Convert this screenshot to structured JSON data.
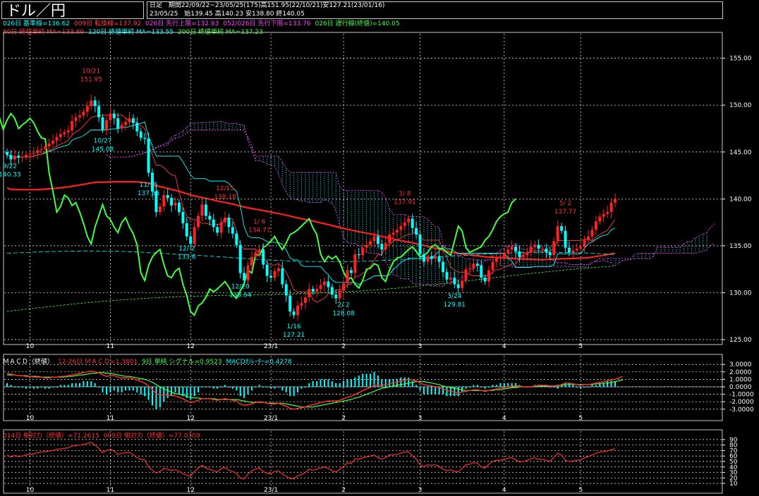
{
  "header": {
    "title": "ドル／円",
    "period_label": "日足",
    "range_line": "期間22/09/22~23/05/25(175)高151.95(22/10/21)安127.21(23/01/16)",
    "last_date": "23/05/25",
    "ohlc_line": "始139.45 高140.23 安138.80 終140.05"
  },
  "legend_main_1": [
    {
      "text": "026日 基準線=136.62",
      "color": "#00ffff"
    },
    {
      "text": "009日 転換線=137.92",
      "color": "#ff4040"
    },
    {
      "text": "026日 先行上限=132.93",
      "color": "#ff40ff"
    },
    {
      "text": "052/026日 先行下限=133.76",
      "color": "#ff40ff"
    },
    {
      "text": "026日 遅行線(終値)=140.05",
      "color": "#40ff40"
    }
  ],
  "legend_main_2": [
    {
      "text": "80日 終値単純 MA=133.80",
      "color": "#ff3030"
    },
    {
      "text": "120日 終値単純 MA=133.55",
      "color": "#00ffff"
    },
    {
      "text": "200日 終値単純 MA=137.23",
      "color": "#40ff40"
    }
  ],
  "legend_macd": [
    {
      "text": "ＭＡＣＤ（終値）",
      "color": "#ffffff"
    },
    {
      "text": "12-26日 ＭＡＣＤ=1.3801",
      "color": "#ff3030"
    },
    {
      "text": "9日 単純 シグナル=0.9523",
      "color": "#40ff40"
    },
    {
      "text": "MACDｵｼﾚｰﾀｰ=0.4278",
      "color": "#00ffff"
    }
  ],
  "legend_rsi": [
    {
      "text": "014日 相対力（終値）=71.2615",
      "color": "#ff3030"
    },
    {
      "text": "009日 相対力（終値）=77.0309",
      "color": "#ff3030"
    }
  ],
  "chart_data": [
    {
      "type": "candlestick",
      "title": "ドル／円",
      "ylim": [
        125,
        157
      ],
      "y_ticks": [
        "155.00",
        "150.00",
        "145.00",
        "140.00",
        "135.00",
        "130.00",
        "125.00"
      ],
      "x_ticks": [
        {
          "label": "10",
          "index": 6
        },
        {
          "label": "11",
          "index": 27
        },
        {
          "label": "12",
          "index": 48
        },
        {
          "label": "23/1",
          "index": 69
        },
        {
          "label": "2",
          "index": 88
        },
        {
          "label": "3",
          "index": 108
        },
        {
          "label": "4",
          "index": 130
        },
        {
          "label": "5",
          "index": 150
        }
      ],
      "close": [
        144.7,
        144.2,
        144.6,
        144.4,
        144.5,
        144.7,
        144.8,
        144.9,
        145.2,
        145.3,
        145.6,
        145.9,
        146.2,
        146.6,
        146.9,
        147.1,
        147.3,
        148.3,
        148.7,
        148.9,
        149.3,
        149.9,
        150.5,
        149.9,
        148.7,
        147.4,
        148.4,
        149.1,
        148.6,
        147.5,
        147.9,
        148.2,
        148.6,
        148.1,
        147.2,
        146.5,
        146.4,
        142.8,
        140.8,
        138.6,
        139.2,
        140.4,
        140.1,
        139.3,
        139.6,
        138.6,
        137.4,
        136.0,
        135.2,
        137.0,
        138.2,
        139.4,
        138.2,
        137.8,
        137.0,
        136.4,
        137.5,
        138.0,
        137.0,
        136.3,
        135.1,
        132.1,
        131.3,
        132.9,
        133.8,
        134.3,
        134.6,
        133.0,
        131.8,
        131.6,
        132.3,
        132.6,
        130.9,
        129.7,
        128.0,
        127.6,
        128.6,
        128.9,
        129.5,
        130.4,
        130.1,
        130.4,
        130.8,
        131.2,
        130.6,
        129.8,
        129.4,
        130.2,
        131.0,
        132.4,
        132.1,
        134.1,
        134.0,
        134.8,
        135.1,
        135.5,
        136.0,
        135.2,
        134.6,
        135.3,
        136.2,
        136.4,
        136.7,
        137.1,
        137.5,
        137.9,
        136.9,
        136.2,
        134.1,
        133.3,
        133.9,
        133.6,
        133.9,
        133.3,
        132.2,
        131.4,
        131.6,
        130.9,
        130.5,
        131.3,
        132.5,
        132.6,
        133.1,
        132.9,
        131.6,
        131.2,
        132.4,
        133.3,
        133.7,
        133.8,
        134.2,
        134.6,
        134.9,
        134.4,
        133.8,
        134.0,
        134.3,
        134.9,
        135.1,
        134.7,
        134.7,
        134.3,
        134.0,
        135.5,
        137.1,
        136.6,
        134.8,
        134.3,
        134.5,
        134.7,
        134.9,
        135.6,
        136.0,
        136.7,
        137.6,
        138.1,
        138.4,
        138.6,
        139.6,
        140.0
      ],
      "highs_labels": [
        {
          "date": "10/21",
          "value": "151.95",
          "index": 22
        },
        {
          "date": "12/15",
          "value": "138.18",
          "index": 57
        },
        {
          "date": "3/ 8",
          "value": "137.91",
          "index": 104
        },
        {
          "date": "5/ 2",
          "value": "137.77",
          "index": 146
        },
        {
          "date": "1/ 6",
          "value": "134.77",
          "index": 66
        }
      ],
      "lows_labels": [
        {
          "date": "10/27",
          "value": "145.08",
          "index": 25
        },
        {
          "date": "11/15",
          "value": "137.65",
          "index": 37
        },
        {
          "date": "12/ 2",
          "value": "133.6",
          "index": 47
        },
        {
          "date": "12/20",
          "value": "130.54",
          "index": 61
        },
        {
          "date": "1/16",
          "value": "127.21",
          "index": 75
        },
        {
          "date": "2/ 2",
          "value": "128.08",
          "index": 88
        },
        {
          "date": "3/24",
          "value": "129.81",
          "index": 117
        },
        {
          "date": "9/22",
          "value": "140.33",
          "index": 0
        }
      ],
      "series": [
        {
          "name": "026日 基準線",
          "last": 136.62,
          "color": "#00ffff"
        },
        {
          "name": "009日 転換線",
          "last": 137.92,
          "color": "#ff4040"
        },
        {
          "name": "026日 先行上限",
          "last": 132.93,
          "color": "#ff40ff"
        },
        {
          "name": "052/026日 先行下限",
          "last": 133.76,
          "color": "#ff40ff"
        },
        {
          "name": "026日 遅行線(終値)",
          "last": 140.05,
          "color": "#40ff40"
        },
        {
          "name": "80日 終値単純 MA",
          "last": 133.8,
          "color": "#ff3030"
        },
        {
          "name": "120日 終値単純 MA",
          "last": 133.55,
          "color": "#00ffff"
        },
        {
          "name": "200日 終値単純 MA",
          "last": 137.23,
          "color": "#40ff40"
        }
      ],
      "colors": {
        "up": "#ff2020",
        "down": "#00ffff",
        "grid": "#ffffff"
      }
    },
    {
      "type": "line",
      "title": "ＭＡＣＤ（終値）",
      "ylim": [
        -3.4,
        3.4
      ],
      "y_ticks": [
        "3.0000",
        "2.0000",
        "1.0000",
        "0.0000",
        "-1.0000",
        "-2.0000",
        "-3.0000"
      ],
      "macd": [
        1.8,
        1.7,
        1.6,
        1.5,
        1.5,
        1.4,
        1.4,
        1.3,
        1.3,
        1.3,
        1.2,
        1.2,
        1.3,
        1.3,
        1.4,
        1.4,
        1.5,
        1.6,
        1.7,
        1.8,
        1.9,
        2.0,
        2.1,
        2.0,
        1.9,
        1.6,
        1.4,
        1.5,
        1.5,
        1.3,
        1.2,
        1.2,
        1.2,
        1.1,
        0.9,
        0.7,
        0.5,
        0.1,
        -0.4,
        -0.9,
        -1.1,
        -1.1,
        -1.1,
        -1.2,
        -1.2,
        -1.4,
        -1.6,
        -1.9,
        -2.1,
        -2.0,
        -1.8,
        -1.6,
        -1.6,
        -1.6,
        -1.7,
        -1.8,
        -1.7,
        -1.6,
        -1.7,
        -1.8,
        -1.9,
        -2.3,
        -2.5,
        -2.4,
        -2.3,
        -2.1,
        -2.0,
        -2.1,
        -2.2,
        -2.3,
        -2.3,
        -2.2,
        -2.4,
        -2.6,
        -2.9,
        -3.0,
        -2.9,
        -2.8,
        -2.7,
        -2.5,
        -2.4,
        -2.3,
        -2.1,
        -2.0,
        -1.9,
        -1.9,
        -1.9,
        -1.8,
        -1.6,
        -1.4,
        -1.3,
        -1.0,
        -0.8,
        -0.5,
        -0.3,
        -0.1,
        0.2,
        0.2,
        0.2,
        0.3,
        0.4,
        0.5,
        0.6,
        0.8,
        0.9,
        1.0,
        0.9,
        0.8,
        0.5,
        0.3,
        0.2,
        0.1,
        0.0,
        -0.1,
        -0.3,
        -0.5,
        -0.6,
        -0.7,
        -0.8,
        -0.7,
        -0.6,
        -0.5,
        -0.4,
        -0.4,
        -0.5,
        -0.6,
        -0.5,
        -0.4,
        -0.3,
        -0.2,
        -0.1,
        0.0,
        0.1,
        0.1,
        0.1,
        0.0,
        0.0,
        0.0,
        0.1,
        0.2,
        0.2,
        0.2,
        0.1,
        0.1,
        0.1,
        0.3,
        0.5,
        0.5,
        0.4,
        0.3,
        0.2,
        0.3,
        0.3,
        0.4,
        0.5,
        0.6,
        0.7,
        0.8,
        0.9,
        1.0,
        1.2,
        1.38
      ],
      "signal": [
        1.6,
        1.6,
        1.6,
        1.5,
        1.5,
        1.5,
        1.4,
        1.4,
        1.4,
        1.3,
        1.3,
        1.3,
        1.3,
        1.3,
        1.3,
        1.3,
        1.4,
        1.4,
        1.5,
        1.6,
        1.6,
        1.7,
        1.8,
        1.8,
        1.9,
        1.9,
        1.8,
        1.8,
        1.7,
        1.6,
        1.5,
        1.4,
        1.4,
        1.3,
        1.2,
        1.1,
        1.0,
        0.8,
        0.6,
        0.3,
        0.0,
        -0.3,
        -0.5,
        -0.7,
        -0.9,
        -1.0,
        -1.1,
        -1.3,
        -1.4,
        -1.5,
        -1.5,
        -1.6,
        -1.6,
        -1.6,
        -1.6,
        -1.7,
        -1.7,
        -1.7,
        -1.7,
        -1.7,
        -1.7,
        -1.8,
        -1.9,
        -2.0,
        -2.1,
        -2.1,
        -2.1,
        -2.1,
        -2.2,
        -2.2,
        -2.2,
        -2.2,
        -2.2,
        -2.3,
        -2.4,
        -2.5,
        -2.6,
        -2.7,
        -2.7,
        -2.7,
        -2.7,
        -2.6,
        -2.5,
        -2.4,
        -2.3,
        -2.2,
        -2.1,
        -2.0,
        -1.9,
        -1.8,
        -1.7,
        -1.5,
        -1.4,
        -1.2,
        -1.0,
        -0.8,
        -0.6,
        -0.4,
        -0.2,
        -0.1,
        0.0,
        0.1,
        0.2,
        0.3,
        0.4,
        0.5,
        0.6,
        0.7,
        0.7,
        0.7,
        0.6,
        0.5,
        0.4,
        0.3,
        0.1,
        0.0,
        -0.1,
        -0.2,
        -0.3,
        -0.4,
        -0.5,
        -0.5,
        -0.5,
        -0.5,
        -0.5,
        -0.5,
        -0.5,
        -0.5,
        -0.4,
        -0.4,
        -0.3,
        -0.2,
        -0.1,
        -0.1,
        0.0,
        0.0,
        0.0,
        0.0,
        0.0,
        0.1,
        0.1,
        0.1,
        0.1,
        0.1,
        0.2,
        0.2,
        0.3,
        0.3,
        0.3,
        0.3,
        0.3,
        0.3,
        0.3,
        0.3,
        0.4,
        0.4,
        0.5,
        0.5,
        0.6,
        0.7,
        0.8,
        0.95
      ],
      "colors": {
        "macd": "#ff3030",
        "signal": "#40ff40",
        "osc": "#00ffff"
      }
    },
    {
      "type": "line",
      "title": "相対力（終値）",
      "ylim": [
        5,
        95
      ],
      "y_ticks": [
        "90",
        "80",
        "70",
        "60",
        "50",
        "40",
        "30",
        "20",
        "10"
      ],
      "rsi14": [
        62,
        58,
        61,
        59,
        60,
        62,
        63,
        64,
        66,
        67,
        68,
        69,
        70,
        72,
        73,
        74,
        75,
        78,
        79,
        80,
        81,
        83,
        85,
        80,
        74,
        66,
        70,
        72,
        69,
        63,
        65,
        66,
        67,
        62,
        57,
        54,
        53,
        40,
        34,
        29,
        32,
        37,
        36,
        33,
        35,
        32,
        28,
        25,
        23,
        32,
        38,
        43,
        38,
        36,
        33,
        31,
        37,
        39,
        34,
        32,
        28,
        20,
        18,
        27,
        33,
        36,
        38,
        32,
        28,
        28,
        32,
        33,
        27,
        23,
        19,
        18,
        24,
        26,
        30,
        36,
        34,
        36,
        38,
        40,
        37,
        33,
        31,
        36,
        41,
        48,
        46,
        55,
        54,
        57,
        58,
        60,
        62,
        57,
        54,
        57,
        62,
        62,
        63,
        65,
        67,
        68,
        60,
        55,
        44,
        40,
        44,
        43,
        44,
        41,
        36,
        33,
        35,
        32,
        31,
        37,
        44,
        45,
        48,
        47,
        40,
        38,
        45,
        50,
        52,
        52,
        54,
        56,
        57,
        53,
        49,
        50,
        52,
        55,
        57,
        54,
        54,
        52,
        50,
        58,
        65,
        62,
        52,
        50,
        51,
        52,
        53,
        57,
        59,
        62,
        65,
        67,
        68,
        69,
        72,
        73
      ]
    }
  ]
}
